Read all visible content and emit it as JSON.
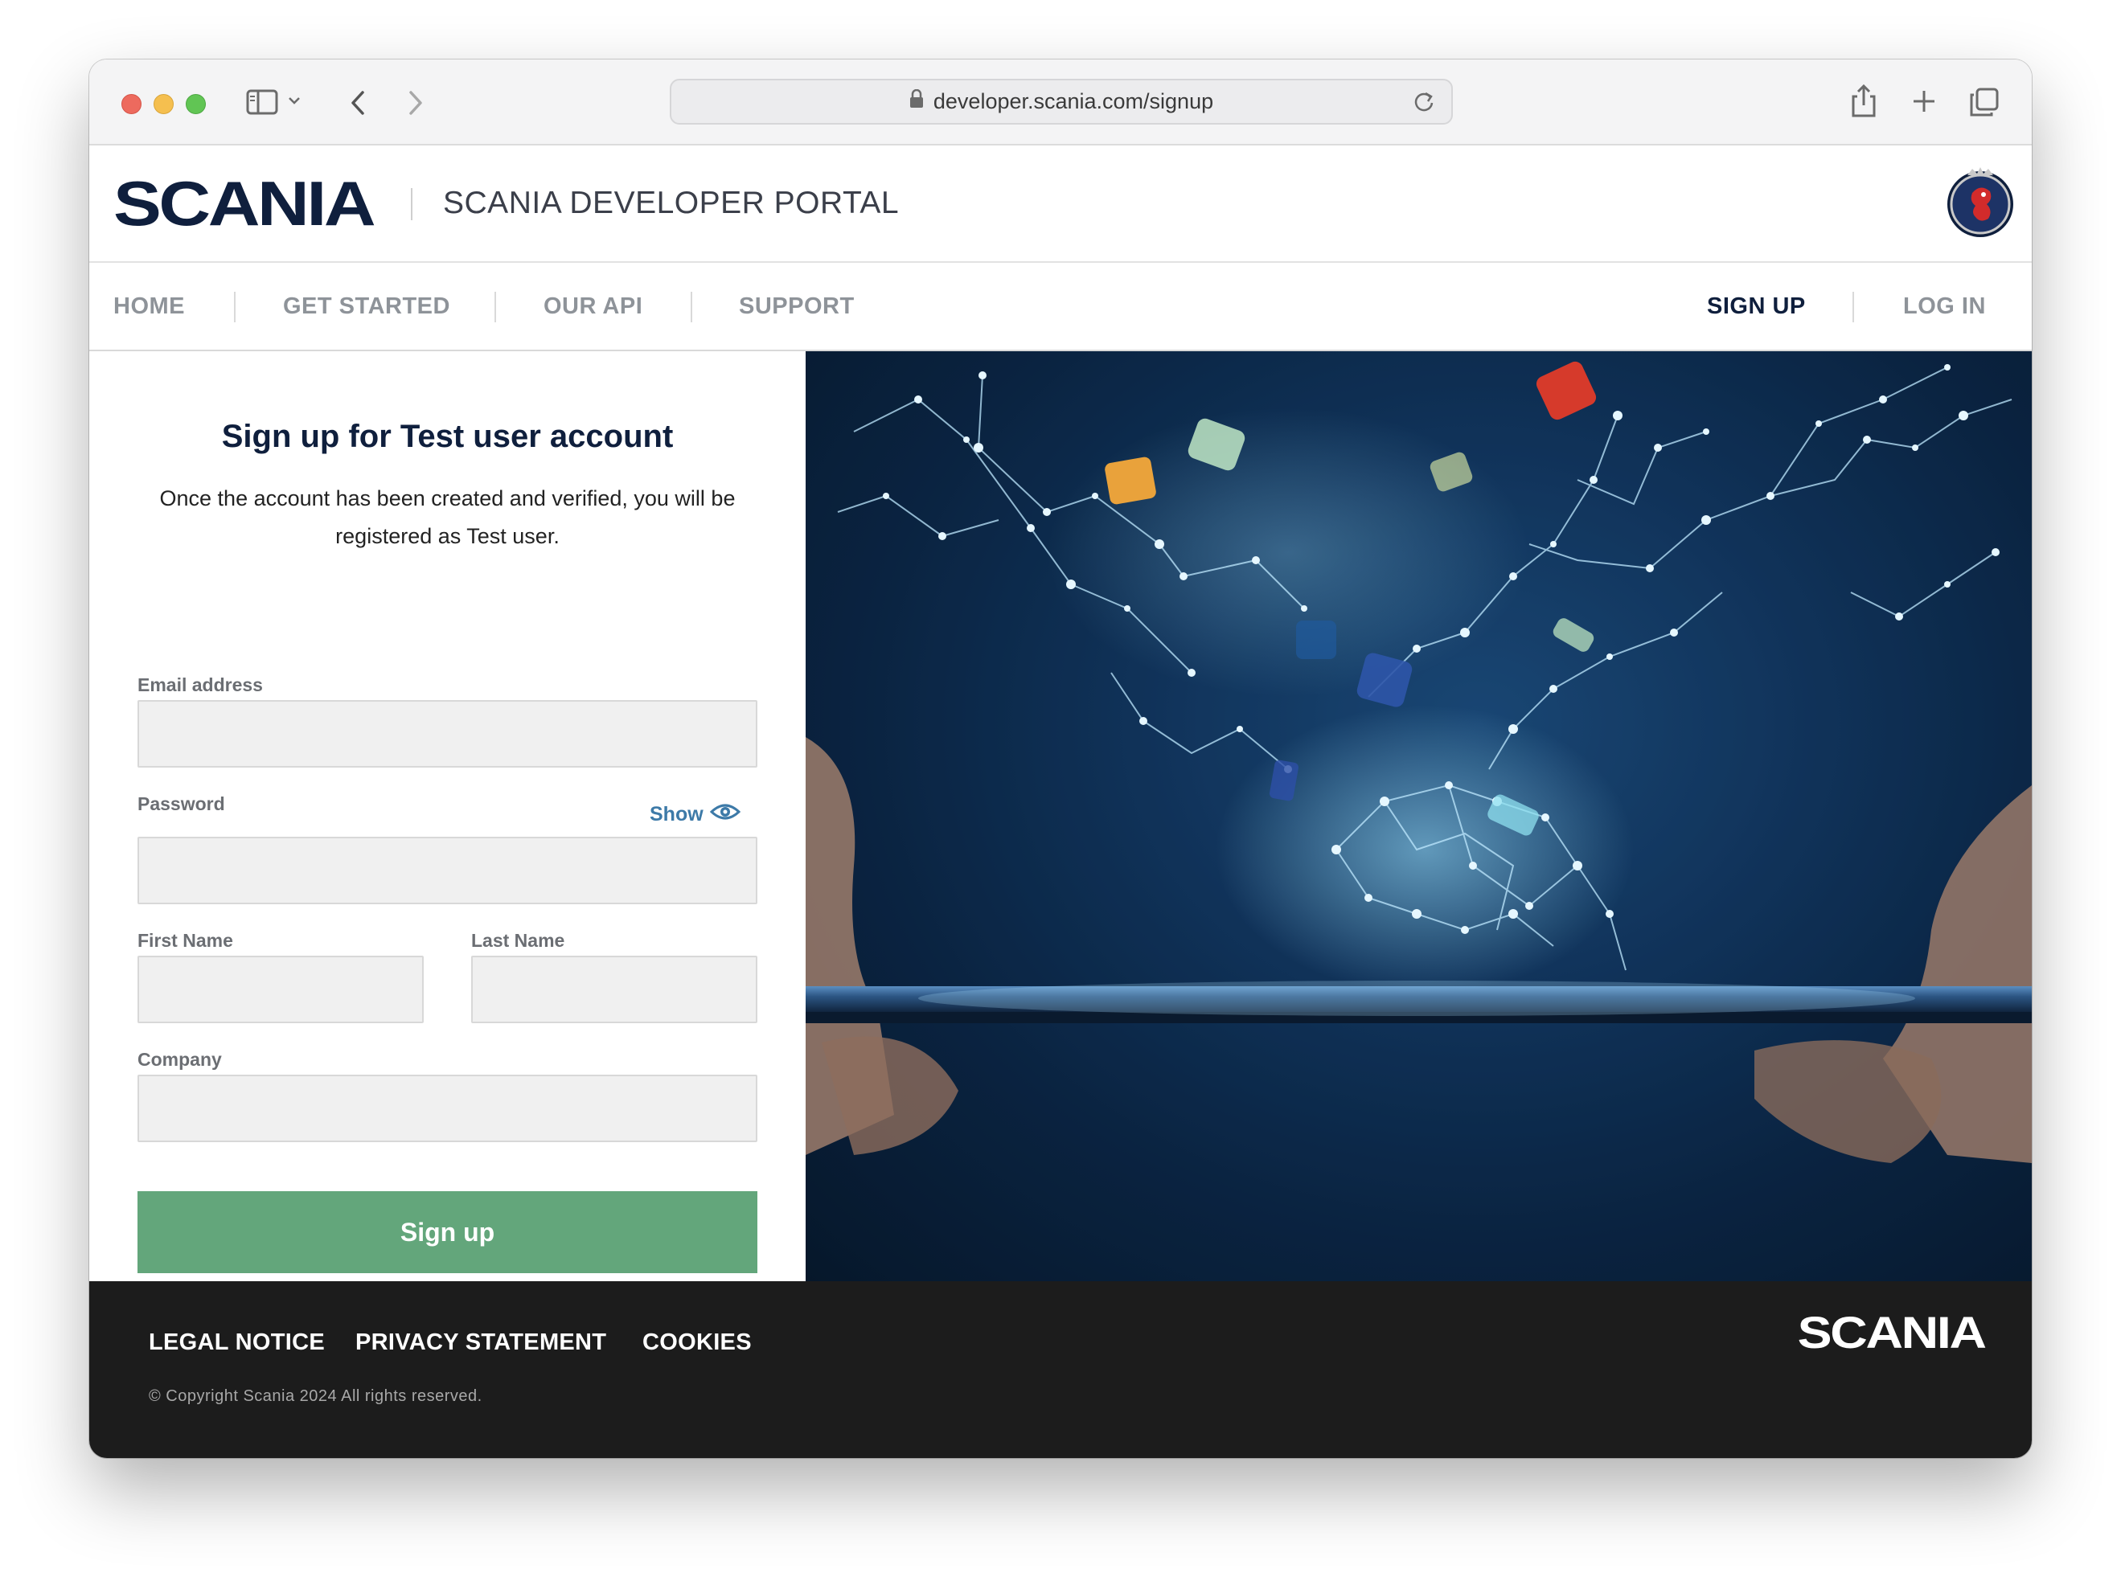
{
  "browser": {
    "url": "developer.scania.com/signup"
  },
  "header": {
    "logo_text": "SCANIA",
    "portal_title": "SCANIA DEVELOPER PORTAL"
  },
  "nav": {
    "items": [
      {
        "label": "HOME"
      },
      {
        "label": "GET STARTED"
      },
      {
        "label": "OUR API"
      },
      {
        "label": "SUPPORT"
      }
    ],
    "signup": "SIGN UP",
    "login": "LOG IN",
    "active_color": "#0f1f3d",
    "inactive_color": "#8e9399"
  },
  "form": {
    "title": "Sign up for Test user account",
    "description": "Once the account has been created and verified, you will be registered as Test user.",
    "email_label": "Email address",
    "email_value": "",
    "password_label": "Password",
    "password_value": "",
    "show_label": "Show",
    "first_name_label": "First Name",
    "first_name_value": "",
    "last_name_label": "Last Name",
    "last_name_value": "",
    "company_label": "Company",
    "company_value": "",
    "submit_label": "Sign up",
    "button_color": "#63a67b"
  },
  "footer": {
    "links": [
      "LEGAL NOTICE",
      "PRIVACY STATEMENT",
      "COOKIES"
    ],
    "copyright": "© Copyright Scania 2024 All rights reserved.",
    "logo_text": "SCANIA"
  }
}
